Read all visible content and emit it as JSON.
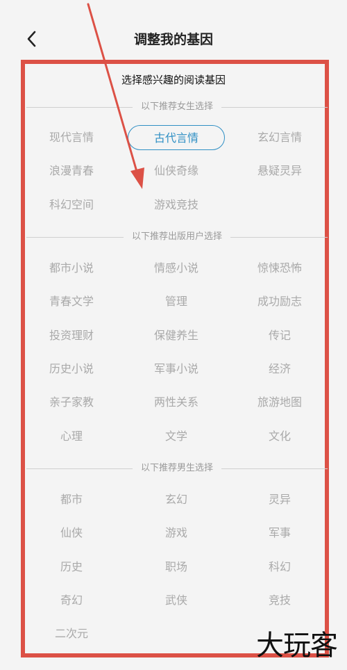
{
  "header": {
    "title": "调整我的基因"
  },
  "subtitle": "选择感兴趣的阅读基因",
  "sections": [
    {
      "label": "以下推荐女生选择",
      "tags": [
        "现代言情",
        "古代言情",
        "玄幻言情",
        "浪漫青春",
        "仙侠奇缘",
        "悬疑灵异",
        "科幻空间",
        "游戏竞技"
      ],
      "selected": "古代言情"
    },
    {
      "label": "以下推荐出版用户选择",
      "tags": [
        "都市小说",
        "情感小说",
        "惊悚恐怖",
        "青春文学",
        "管理",
        "成功励志",
        "投资理财",
        "保健养生",
        "传记",
        "历史小说",
        "军事小说",
        "经济",
        "亲子家教",
        "两性关系",
        "旅游地图",
        "心理",
        "文学",
        "文化"
      ]
    },
    {
      "label": "以下推荐男生选择",
      "tags": [
        "都市",
        "玄幻",
        "灵异",
        "仙侠",
        "游戏",
        "军事",
        "历史",
        "职场",
        "科幻",
        "奇幻",
        "武侠",
        "竞技",
        "二次元"
      ]
    }
  ],
  "colors": {
    "accent": "#2f8fc4",
    "frame": "#dc5146",
    "muted": "#a9a9a9"
  },
  "watermark": "大玩客"
}
